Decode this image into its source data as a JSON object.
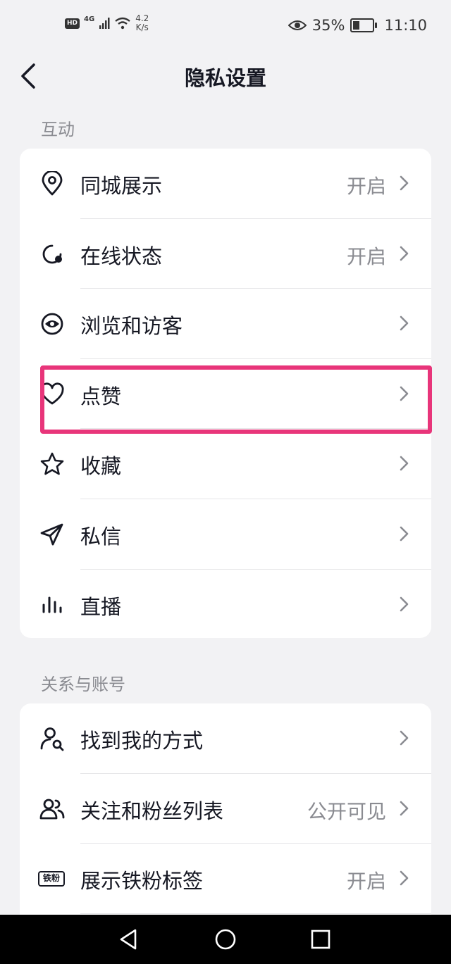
{
  "status_bar": {
    "hd": "HD",
    "network": "4G",
    "net_speed_value": "4.2",
    "net_speed_unit": "K/s",
    "battery": "35%",
    "time": "11:10"
  },
  "header": {
    "title": "隐私设置"
  },
  "sections": [
    {
      "label": "互动",
      "items": [
        {
          "label": "同城展示",
          "value": "开启",
          "icon": "location-pin-icon"
        },
        {
          "label": "在线状态",
          "value": "开启",
          "icon": "online-status-icon"
        },
        {
          "label": "浏览和访客",
          "value": "",
          "icon": "eye-icon"
        },
        {
          "label": "点赞",
          "value": "",
          "icon": "heart-icon"
        },
        {
          "label": "收藏",
          "value": "",
          "icon": "star-icon"
        },
        {
          "label": "私信",
          "value": "",
          "icon": "paper-plane-icon"
        },
        {
          "label": "直播",
          "value": "",
          "icon": "bar-chart-icon"
        }
      ]
    },
    {
      "label": "关系与账号",
      "items": [
        {
          "label": "找到我的方式",
          "value": "",
          "icon": "user-search-icon"
        },
        {
          "label": "关注和粉丝列表",
          "value": "公开可见",
          "icon": "users-icon"
        },
        {
          "label": "展示铁粉标签",
          "value": "开启",
          "icon": "fan-badge-icon",
          "badge_text": "铁粉"
        }
      ]
    }
  ],
  "colors": {
    "highlight": "#e8357a",
    "background": "#f2f2f4",
    "secondary_text": "#8a8b91"
  }
}
